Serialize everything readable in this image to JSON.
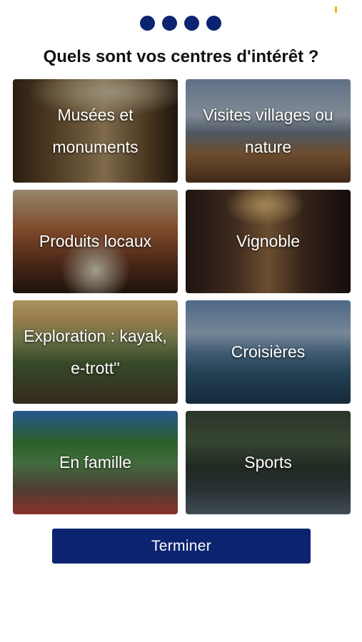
{
  "colors": {
    "accent": "#0c2470",
    "status_mark": "#f2b705",
    "background": "#ffffff",
    "title_text": "#111111",
    "tile_text": "#ffffff"
  },
  "progress": {
    "steps_total": 4,
    "steps_shown_filled": 4
  },
  "title": "Quels sont vos centres d'intérêt ?",
  "interests": [
    {
      "label": "Musées et monuments",
      "line1": "Musées et",
      "line2": "monuments"
    },
    {
      "label": "Visites villages ou nature",
      "line1": "Visites villages ou",
      "line2": "nature"
    },
    {
      "label": "Produits locaux"
    },
    {
      "label": "Vignoble"
    },
    {
      "label": "Exploration : kayak, e-trott''",
      "line1": "Exploration : kayak,",
      "line2": "e-trott''"
    },
    {
      "label": "Croisières"
    },
    {
      "label": "En famille"
    },
    {
      "label": "Sports"
    }
  ],
  "finish_button": "Terminer"
}
